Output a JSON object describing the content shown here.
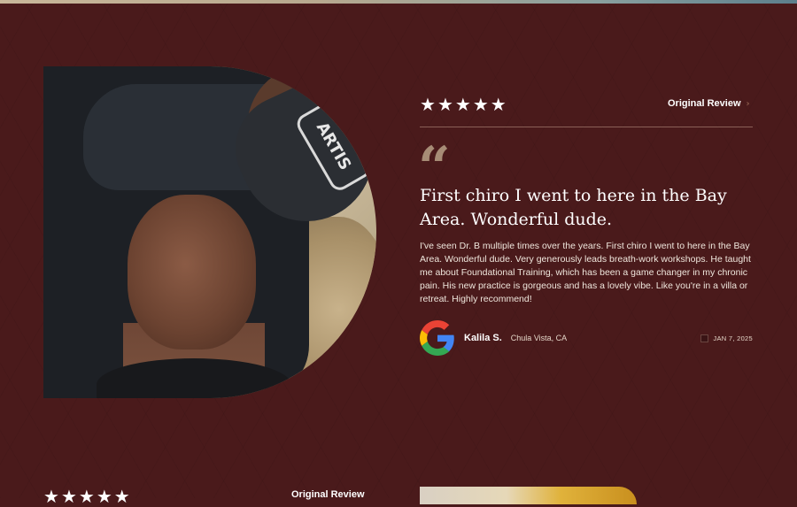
{
  "colors": {
    "background": "#4a1a1b",
    "accent_quote": "#a78c76",
    "text": "#ffffff"
  },
  "review": {
    "stars": [
      "★",
      "★",
      "★",
      "★",
      "★"
    ],
    "rating": 5,
    "original_review_label": "Original Review",
    "quote_glyph": "“",
    "headline": "First chiro I went to here in the Bay Area. Wonderful dude.",
    "body": "I've seen Dr. B multiple times over the years. First chiro I went to here in the Bay Area. Wonderful dude. Very generously leads breath-work workshops. He taught me about Foundational Training, which has been a game changer in my chronic pain. His new practice is gorgeous and has a lovely vibe. Like you're in a villa or retreat. Highly recommend!",
    "author_name": "Kalila S.",
    "author_location": "Chula Vista, CA",
    "date": "JAN 7, 2025",
    "photo_cap_text": "ARTIS",
    "source_icon": "google-logo-icon"
  },
  "next_review": {
    "stars": [
      "★",
      "★",
      "★",
      "★",
      "★"
    ],
    "original_review_label": "Original Review"
  }
}
